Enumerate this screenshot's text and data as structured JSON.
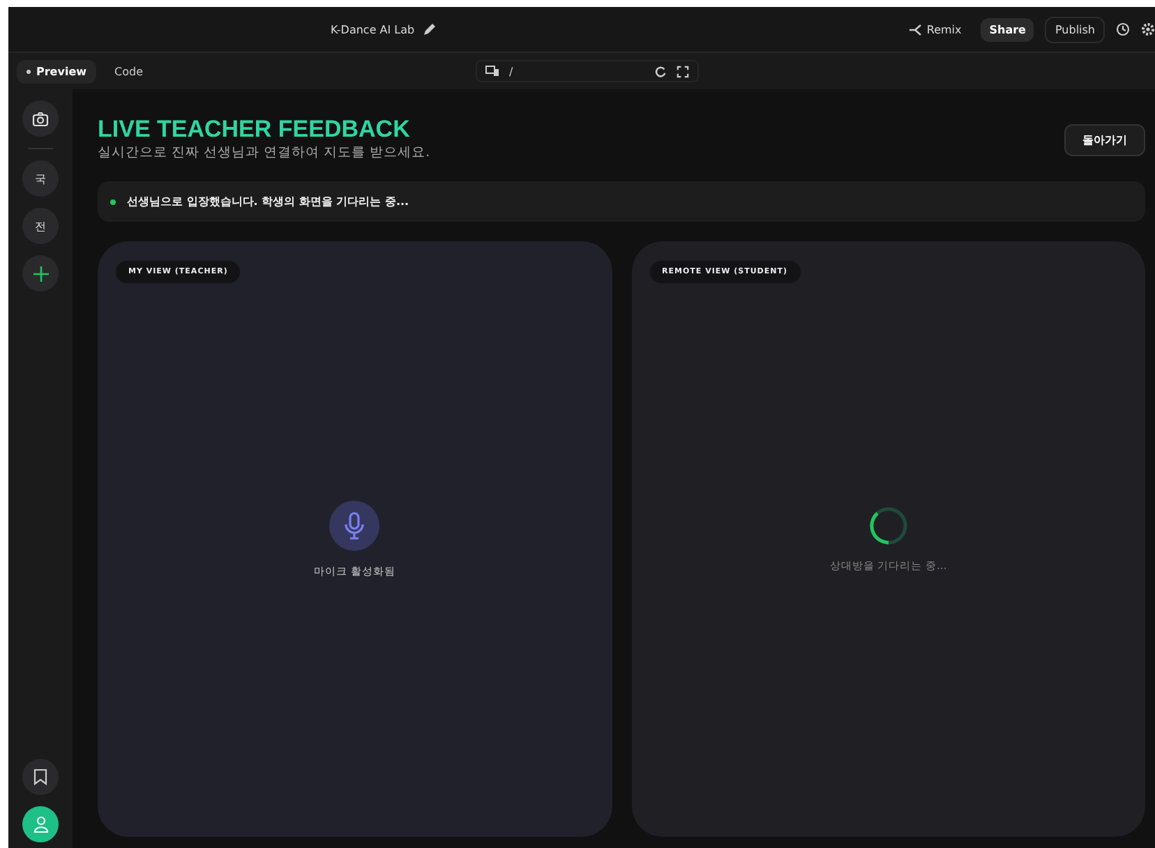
{
  "topbar": {
    "title": "K-Dance AI Lab",
    "actions": [
      {
        "label": "Remix",
        "kind": "link"
      },
      {
        "label": "Share",
        "kind": "filled"
      },
      {
        "label": "Publish",
        "kind": "outline"
      }
    ]
  },
  "toolbar": {
    "tabs": [
      {
        "label": "Preview",
        "selected": true
      },
      {
        "label": "Code",
        "selected": false
      }
    ],
    "path": "/"
  },
  "sidebar": {
    "items": [
      {
        "kind": "camera"
      },
      {
        "kind": "divider"
      },
      {
        "kind": "letter",
        "label": "국"
      },
      {
        "kind": "letter",
        "label": "전"
      },
      {
        "kind": "add"
      }
    ],
    "bottom": [
      {
        "kind": "bookmark"
      },
      {
        "kind": "user"
      }
    ]
  },
  "header": {
    "title": "LIVE TEACHER FEEDBACK",
    "subtitle": "실시간으로 진짜 선생님과 연결하여 지도를 받으세요.",
    "back_button": "돌아가기"
  },
  "status": {
    "text": "선생님으로 입장했습니다. 학생의 화면을 기다리는 중...",
    "color": "#22c55e"
  },
  "panels": [
    {
      "label": "MY VIEW (TEACHER)",
      "kind": "mic",
      "caption": "마이크 활성화됨"
    },
    {
      "label": "REMOTE VIEW (STUDENT)",
      "kind": "waiting",
      "caption": "상대방을 기다리는 중..."
    }
  ]
}
